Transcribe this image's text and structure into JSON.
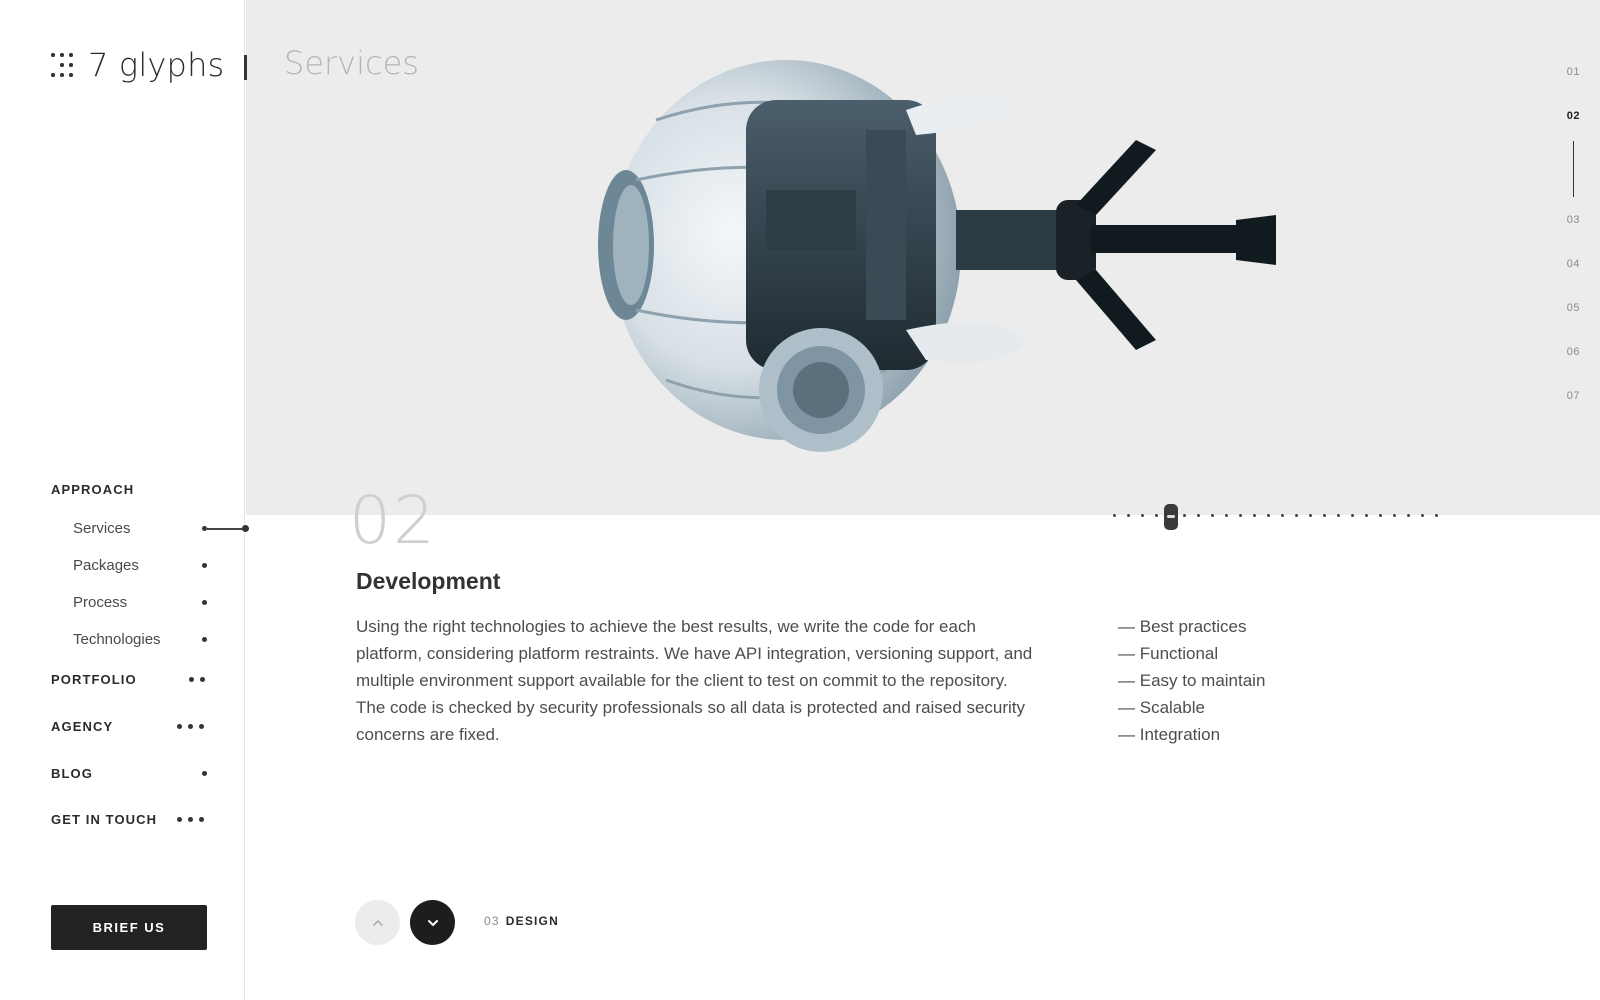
{
  "brand": {
    "name": "7 glyphs"
  },
  "header": {
    "title": "Services"
  },
  "nav": {
    "groups": [
      {
        "label": "APPROACH",
        "items": [
          "Services",
          "Packages",
          "Process",
          "Technologies"
        ]
      },
      {
        "label": "PORTFOLIO"
      },
      {
        "label": "AGENCY"
      },
      {
        "label": "BLOG"
      },
      {
        "label": "GET IN TOUCH"
      }
    ],
    "active_item": "Services"
  },
  "cta": {
    "label": "BRIEF US"
  },
  "pagination": {
    "pages": [
      "01",
      "02",
      "03",
      "04",
      "05",
      "06",
      "07"
    ],
    "active": "02"
  },
  "slider": {
    "count": 24,
    "active_index": 4
  },
  "section": {
    "number": "02",
    "title": "Development",
    "description": "Using the right technologies to achieve the best results, we write the code for each platform, considering platform restraints. We have API integration, versioning support, and multiple environment support available for the client to test on commit to the repository. The code is checked by security professionals so all data is protected and raised security concerns are fixed.",
    "features": [
      "Best practices",
      "Functional",
      "Easy to maintain",
      "Scalable",
      "Integration"
    ]
  },
  "next": {
    "number": "03",
    "label": "DESIGN"
  },
  "colors": {
    "hero_bg": "#ececec",
    "text": "#2b2b2b",
    "muted": "#b5b5b5",
    "button_dark": "#222222"
  }
}
